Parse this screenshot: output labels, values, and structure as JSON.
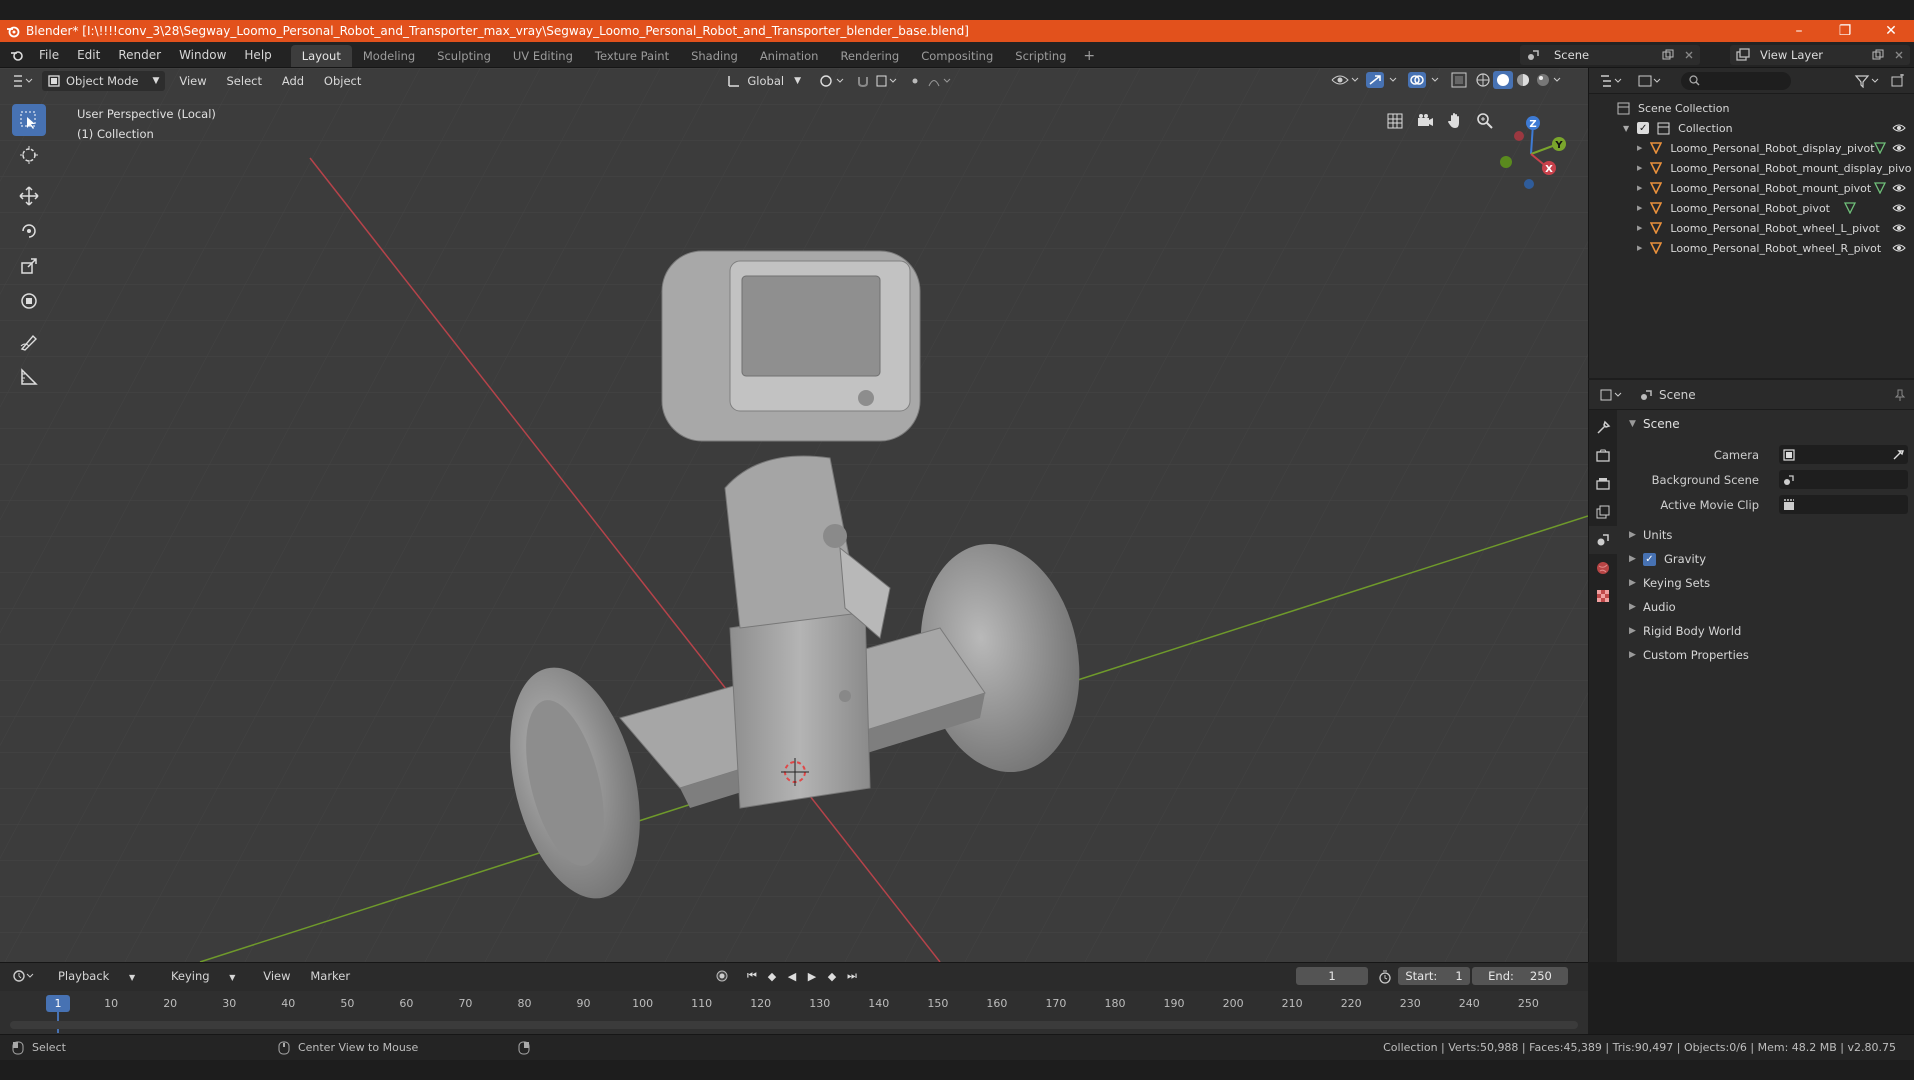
{
  "window": {
    "title": "Blender* [I:\\!!!!conv_3\\28\\Segway_Loomo_Personal_Robot_and_Transporter_max_vray\\Segway_Loomo_Personal_Robot_and_Transporter_blender_base.blend]",
    "minimize": "–",
    "maximize": "❐",
    "close": "✕"
  },
  "menu": [
    "File",
    "Edit",
    "Render",
    "Window",
    "Help"
  ],
  "workspaces": [
    "Layout",
    "Modeling",
    "Sculpting",
    "UV Editing",
    "Texture Paint",
    "Shading",
    "Animation",
    "Rendering",
    "Compositing",
    "Scripting"
  ],
  "workspace_add": "+",
  "scene_selector": "Scene",
  "view_layer_selector": "View Layer",
  "viewport": {
    "mode": "Object Mode",
    "menu": [
      "View",
      "Select",
      "Add",
      "Object"
    ],
    "orientation": "Global",
    "info_line1": "User Perspective (Local)",
    "info_line2": "(1) Collection",
    "gizmo": {
      "x": "X",
      "y": "Y",
      "z": "Z"
    }
  },
  "outliner": {
    "search_placeholder": "",
    "root": "Scene Collection",
    "collection": "Collection",
    "objects": [
      "Loomo_Personal_Robot_display_pivot",
      "Loomo_Personal_Robot_mount_display_pivo",
      "Loomo_Personal_Robot_mount_pivot",
      "Loomo_Personal_Robot_pivot",
      "Loomo_Personal_Robot_wheel_L_pivot",
      "Loomo_Personal_Robot_wheel_R_pivot"
    ]
  },
  "properties": {
    "context": "Scene",
    "panel_title": "Scene",
    "fields": {
      "camera_label": "Camera",
      "background_scene_label": "Background Scene",
      "active_movie_clip_label": "Active Movie Clip"
    },
    "subpanels": {
      "units": "Units",
      "gravity": "Gravity",
      "keying_sets": "Keying Sets",
      "audio": "Audio",
      "rigid_body_world": "Rigid Body World",
      "custom_properties": "Custom Properties"
    },
    "gravity_checked": true
  },
  "timeline": {
    "menu": [
      "Playback",
      "Keying",
      "View",
      "Marker"
    ],
    "current_frame": "1",
    "start_label": "Start:",
    "start_value": "1",
    "end_label": "End:",
    "end_value": "250",
    "ruler_current": "1",
    "ticks": [
      "10",
      "20",
      "30",
      "40",
      "50",
      "60",
      "70",
      "80",
      "90",
      "100",
      "110",
      "120",
      "130",
      "140",
      "150",
      "160",
      "170",
      "180",
      "190",
      "200",
      "210",
      "220",
      "230",
      "240",
      "250"
    ]
  },
  "status": {
    "select": "Select",
    "center_view": "Center View to Mouse",
    "stats": "Collection | Verts:50,988 | Faces:45,389 | Tris:90,497 | Objects:0/6 | Mem: 48.2 MB | v2.80.75"
  },
  "colors": {
    "title_bar": "#e2511c",
    "accent": "#4772b3",
    "viewport_bg": "#3c3c3c",
    "x_axis": "#c8414b",
    "y_axis": "#7aa52c",
    "object_icon": "#e8903c"
  }
}
